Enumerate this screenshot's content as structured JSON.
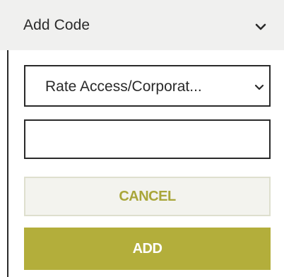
{
  "header": {
    "title": "Add Code",
    "toggle_icon": "chevron-down-icon"
  },
  "form": {
    "code_type": {
      "selected": "Rate Access/Corporat...",
      "icon": "chevron-down-icon"
    },
    "code_input": {
      "value": "",
      "placeholder": ""
    },
    "cancel_label": "CANCEL",
    "add_label": "ADD"
  },
  "colors": {
    "header_bg": "#f0f0ef",
    "text": "#2a2a2a",
    "accent": "#b3ae3b",
    "cancel_bg": "#f3f3ee",
    "cancel_border": "#dedfce",
    "cancel_text": "#a9a63a"
  }
}
